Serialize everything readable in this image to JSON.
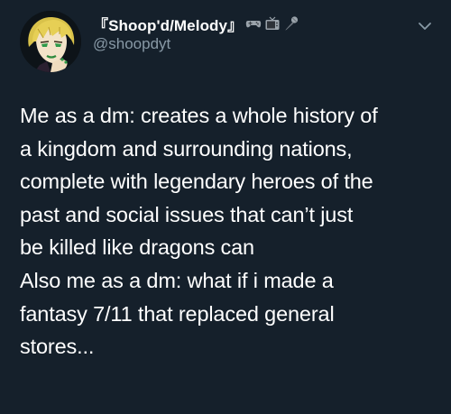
{
  "tweet": {
    "display_name": "『Shoop'd/Melody』",
    "handle": "@shoopdyt",
    "name_emojis": [
      "video-game-controller-icon",
      "television-icon",
      "microphone-icon"
    ],
    "lines": [
      "Me as a dm: creates a whole history of",
      "a kingdom and surrounding nations,",
      "complete with legendary heroes of the",
      "past and social issues that can’t just",
      "be killed like dragons can",
      "Also me as a dm: what if i made a",
      "fantasy 7/11 that replaced general",
      "stores..."
    ]
  },
  "colors": {
    "background": "#15202b",
    "text": "#ffffff",
    "secondary": "#8899a6"
  }
}
